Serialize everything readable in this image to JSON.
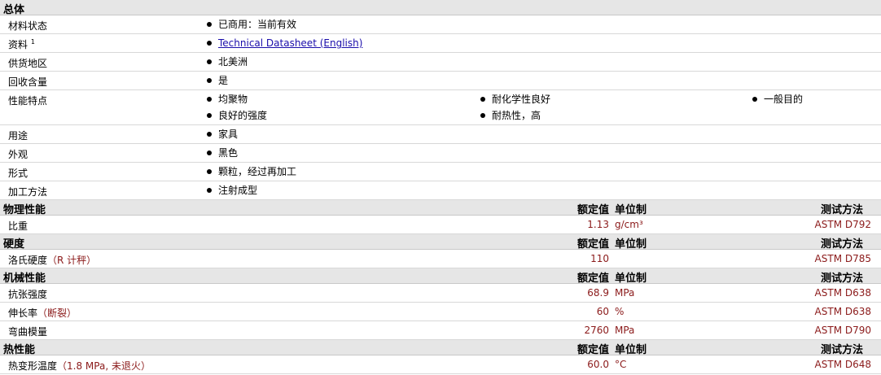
{
  "general": {
    "title": "总体",
    "rows": [
      {
        "label": "材料状态",
        "values": [
          "已商用：当前有效"
        ]
      },
      {
        "label": "资料",
        "sup": "1",
        "values": [
          "Technical Datasheet (English)"
        ],
        "link": true
      },
      {
        "label": "供货地区",
        "values": [
          "北美洲"
        ]
      },
      {
        "label": "回收含量",
        "values": [
          "是"
        ]
      },
      {
        "label": "性能特点",
        "values": [
          "均聚物",
          "耐化学性良好",
          "一般目的",
          "良好的强度",
          "耐热性，高"
        ]
      },
      {
        "label": "用途",
        "values": [
          "家具"
        ]
      },
      {
        "label": "外观",
        "values": [
          "黑色"
        ]
      },
      {
        "label": "形式",
        "values": [
          "颗粒，经过再加工"
        ]
      },
      {
        "label": "加工方法",
        "values": [
          "注射成型"
        ]
      }
    ]
  },
  "columns": {
    "nominal": "额定值",
    "unit": "单位制",
    "method": "测试方法"
  },
  "sections": [
    {
      "title": "物理性能",
      "rows": [
        {
          "label": "比重",
          "value": "1.13",
          "unit": "g/cm³",
          "method": "ASTM D792"
        }
      ]
    },
    {
      "title": "硬度",
      "rows": [
        {
          "label": "洛氏硬度",
          "cond": "（R 计秤）",
          "value": "110",
          "unit": "",
          "method": "ASTM D785"
        }
      ]
    },
    {
      "title": "机械性能",
      "rows": [
        {
          "label": "抗张强度",
          "value": "68.9",
          "unit": "MPa",
          "method": "ASTM D638"
        },
        {
          "label": "伸长率",
          "cond": "（断裂）",
          "value": "60",
          "unit": "%",
          "method": "ASTM D638"
        },
        {
          "label": "弯曲模量",
          "value": "2760",
          "unit": "MPa",
          "method": "ASTM D790"
        }
      ]
    },
    {
      "title": "热性能",
      "rows": [
        {
          "label": "热变形温度",
          "cond": "（1.8 MPa, 未退火）",
          "value": "60.0",
          "unit": "°C",
          "method": "ASTM D648"
        }
      ]
    }
  ]
}
